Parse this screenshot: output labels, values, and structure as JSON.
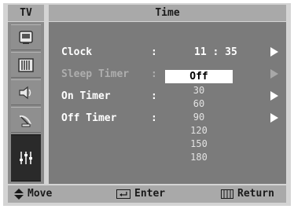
{
  "header": {
    "tv_label": "TV",
    "title": "Time"
  },
  "sidebar": {
    "items": [
      {
        "icon": "picture-icon"
      },
      {
        "icon": "sound-icon"
      },
      {
        "icon": "speaker-icon"
      },
      {
        "icon": "satellite-icon"
      },
      {
        "icon": "setup-icon",
        "active": true
      }
    ]
  },
  "menu": {
    "clock": {
      "label": "Clock",
      "colon": ":",
      "value": "11 : 35"
    },
    "sleep_timer": {
      "label": "Sleep Timer",
      "colon": ":"
    },
    "on_timer": {
      "label": "On Timer",
      "colon": ":"
    },
    "off_timer": {
      "label": "Off Timer",
      "colon": ":"
    }
  },
  "dropdown": {
    "selected": "Off",
    "options": [
      "Off",
      "30",
      "60",
      "90",
      "120",
      "150",
      "180"
    ]
  },
  "footer": {
    "move": "Move",
    "enter": "Enter",
    "return": "Return"
  },
  "colors": {
    "panel": "#7b7b7b",
    "bar": "#a9a9a9",
    "frame": "#d4d4d4",
    "active_icon_bg": "#2a2a2a"
  }
}
